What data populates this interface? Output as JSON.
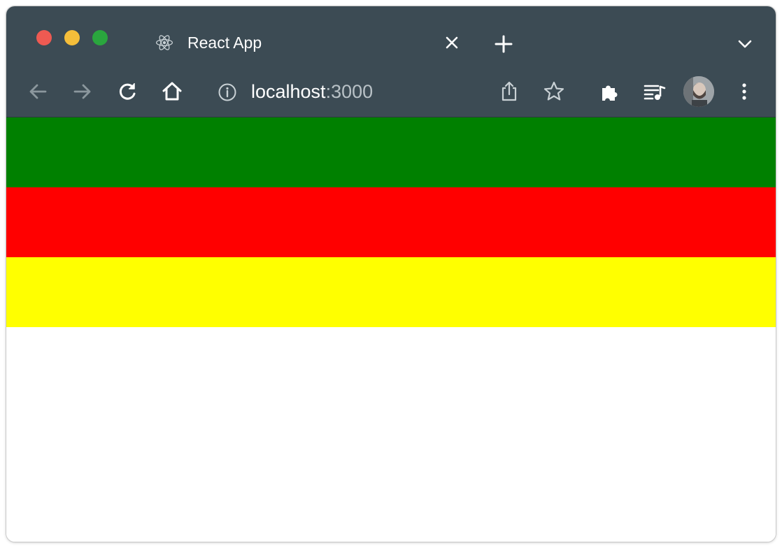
{
  "browser": {
    "tab_title": "React App",
    "url_host": "localhost",
    "url_port": ":3000",
    "icons": [
      "react-icon",
      "close-icon",
      "plus-icon",
      "chevron-down-icon",
      "back-arrow-icon",
      "forward-arrow-icon",
      "reload-icon",
      "home-icon",
      "info-icon",
      "share-icon",
      "star-icon",
      "extensions-icon",
      "media-queue-icon",
      "profile-avatar",
      "more-vert-icon"
    ],
    "colors": {
      "chrome": "#3c4b54",
      "close": "#ee5a52",
      "minimize": "#f5be3a",
      "maximize": "#2aa63e"
    }
  },
  "page": {
    "stripes": [
      {
        "color": "#008000"
      },
      {
        "color": "#ff0000"
      },
      {
        "color": "#ffff00"
      }
    ]
  }
}
